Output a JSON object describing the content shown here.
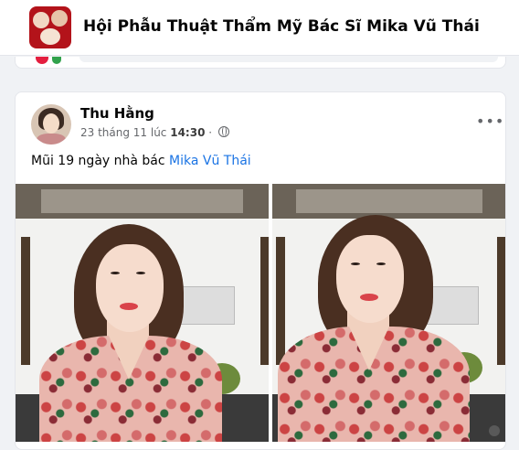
{
  "group": {
    "name": "Hội Phẫu Thuật Thẩm Mỹ Bác Sĩ Mika Vũ Thái"
  },
  "post": {
    "author": "Thu Hằng",
    "date": "23 tháng 11 lúc",
    "time": "14:30",
    "separator": "·",
    "privacy_icon": "globe-icon",
    "more_label": "•••",
    "text_prefix": "Mũi 19 ngày nhà bác",
    "mention": "Mika Vũ Thái",
    "photos": [
      {
        "description_icon": "photo-left"
      },
      {
        "description_icon": "photo-right"
      }
    ]
  },
  "colors": {
    "mention": "#1b74e4",
    "background": "#f0f2f5",
    "card": "#ffffff"
  }
}
